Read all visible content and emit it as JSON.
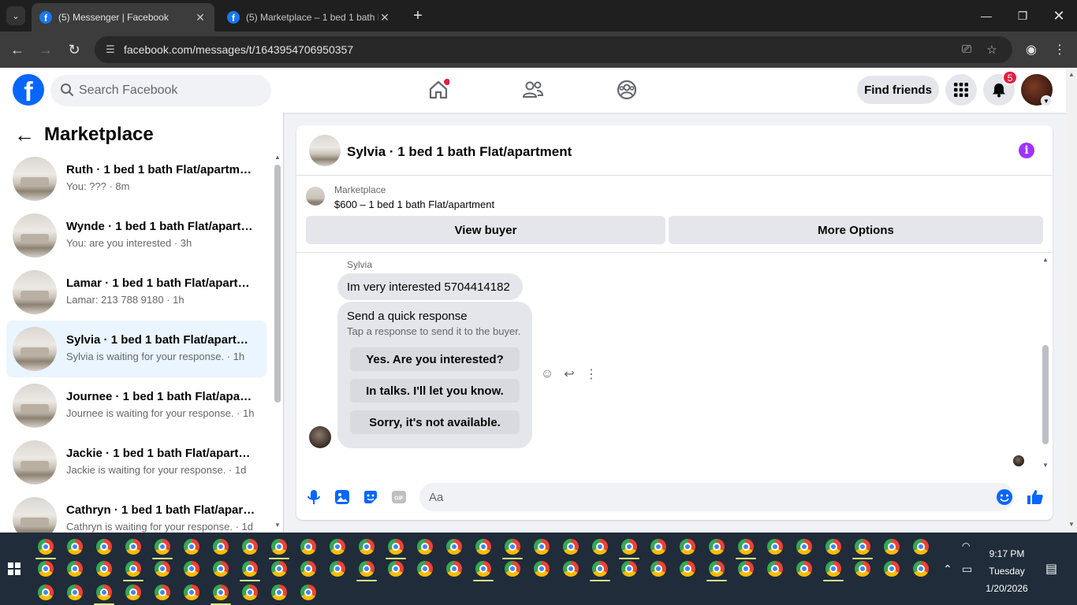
{
  "browser": {
    "tabs": [
      {
        "label": "(5) Messenger | Facebook",
        "active": true
      },
      {
        "label": "(5) Marketplace – 1 bed 1 bath Flat/apartment",
        "active": false
      }
    ],
    "url": "facebook.com/messages/t/1643954706950357"
  },
  "header": {
    "search_placeholder": "Search Facebook",
    "find_friends_label": "Find friends",
    "notification_count": "5"
  },
  "sidebar": {
    "title": "Marketplace",
    "conversations": [
      {
        "name": "Ruth · 1 bed 1 bath Flat/apartment",
        "preview": "You: ??? · 8m"
      },
      {
        "name": "Wynde · 1 bed 1 bath Flat/apartment",
        "preview": "You: are you interested · 3h"
      },
      {
        "name": "Lamar · 1 bed 1 bath Flat/apartment",
        "preview": "Lamar: 213 788 9180 · 1h"
      },
      {
        "name": "Sylvia · 1 bed 1 bath Flat/apartment",
        "preview": "Sylvia is waiting for your response. · 1h",
        "selected": true
      },
      {
        "name": "Journee · 1 bed 1 bath Flat/apartment",
        "preview": "Journee is waiting for your response. · 1h"
      },
      {
        "name": "Jackie · 1 bed 1 bath Flat/apartment",
        "preview": "Jackie is waiting for your response. · 1d"
      },
      {
        "name": "Cathryn · 1 bed 1 bath Flat/apartment",
        "preview": "Cathryn is waiting for your response. · 1d"
      }
    ]
  },
  "chat": {
    "title": "Sylvia · 1 bed 1 bath Flat/apartment",
    "marketplace_label": "Marketplace",
    "listing": "$600 – 1 bed 1 bath Flat/apartment",
    "view_buyer_label": "View buyer",
    "more_options_label": "More Options",
    "sender_name": "Sylvia",
    "message": "Im very interested 5704414182",
    "quick_response_title": "Send a quick response",
    "quick_response_subtitle": "Tap a response to send it to the buyer.",
    "quick_responses": [
      "Yes. Are you interested?",
      "In talks. I'll let you know.",
      "Sorry, it's not available."
    ],
    "composer_placeholder": "Aa"
  },
  "tray": {
    "time": "9:17 PM",
    "day": "Tuesday",
    "date": "1/20/2026"
  }
}
